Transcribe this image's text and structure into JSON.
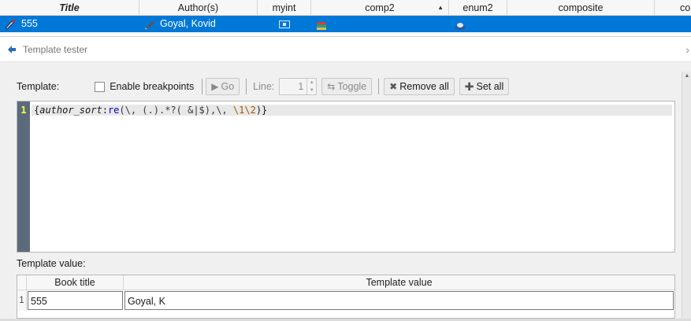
{
  "library": {
    "columns": [
      {
        "label": "Title",
        "w": 177
      },
      {
        "label": "Author(s)",
        "w": 150
      },
      {
        "label": "myint",
        "w": 68
      },
      {
        "label": "comp2",
        "w": 175
      },
      {
        "label": "enum2",
        "w": 74
      },
      {
        "label": "composite",
        "w": 187
      },
      {
        "label": "co",
        "w": 46
      }
    ],
    "sort_indicator": "▲",
    "selected_row": {
      "title": "555",
      "author": "Goyal, Kovid"
    }
  },
  "dialog": {
    "title": "Template tester",
    "close_glyph": "›",
    "template_label": "Template:",
    "enable_breakpoints": "Enable breakpoints",
    "go": "Go",
    "line_label": "Line:",
    "line_value": "1",
    "toggle": "Toggle",
    "remove_all": "Remove all",
    "set_all": "Set all",
    "line_number": "1",
    "code": {
      "open": "{",
      "fn": "author_sort",
      "colon": ":",
      "kw": "re",
      "args_a": "(\\, (.).*?( &|$),\\, ",
      "esc1": "\\1",
      "esc2": "\\2",
      "close": ")}"
    },
    "template_value_label": "Template value:",
    "results": {
      "headers": [
        "Book title",
        "Template value"
      ],
      "rows": [
        {
          "index": "1",
          "book_title": "555",
          "template_value": "Goyal, K"
        }
      ]
    }
  }
}
